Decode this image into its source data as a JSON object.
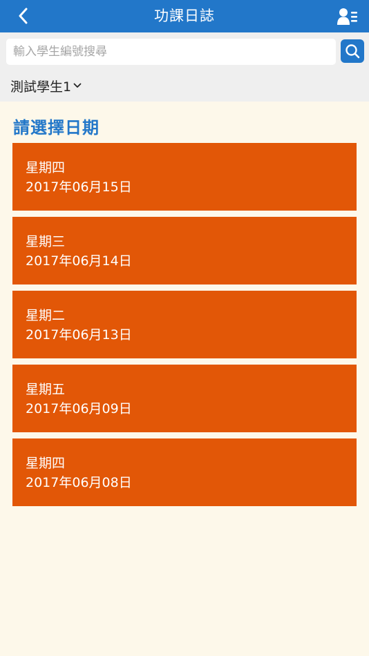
{
  "header": {
    "title": "功課日誌",
    "back_icon": "chevron-left-icon",
    "profile_icon": "user-list-icon"
  },
  "search": {
    "placeholder": "輸入學生編號搜尋",
    "value": "",
    "icon": "search-icon"
  },
  "student": {
    "selected": "測試學生1",
    "icon": "chevron-down-icon"
  },
  "section_title": "請選擇日期",
  "dates": [
    {
      "weekday": "星期四",
      "date": "2017年06月15日"
    },
    {
      "weekday": "星期三",
      "date": "2017年06月14日"
    },
    {
      "weekday": "星期二",
      "date": "2017年06月13日"
    },
    {
      "weekday": "星期五",
      "date": "2017年06月09日"
    },
    {
      "weekday": "星期四",
      "date": "2017年06月08日"
    }
  ],
  "colors": {
    "primary": "#2277c9",
    "item_background": "#e25707",
    "page_background": "#fdf8ea",
    "search_bar_background": "#efefef"
  }
}
